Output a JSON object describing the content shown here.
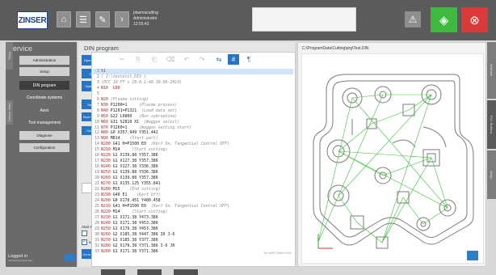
{
  "header": {
    "logo": "ZINSER",
    "user": {
      "line1": "plasmacutting",
      "line2": "Administrator",
      "line3": "12:55:43"
    },
    "icons": [
      "home-icon",
      "list-icon",
      "wrench-icon",
      "chevron-right-icon",
      "warning-icon",
      "start-icon",
      "stop-icon"
    ]
  },
  "left": {
    "title": "Service",
    "menu": [
      "Administration",
      "Setup",
      "DIN program",
      "Coordinate systems",
      "Axes",
      "Tool management",
      "Diagnose",
      "Configuration"
    ],
    "side_tabs": [
      "Setup",
      "Device State"
    ],
    "logged_in": "Logged in",
    "logged_user": "Administrator@domain"
  },
  "din": {
    "title": "DIN program",
    "buttons": [
      "Open current",
      "Open",
      "Open cycle",
      "Save as",
      "Save and load",
      "Close file",
      "Go to plan pos"
    ],
    "number_value": "0",
    "start_prog": "Start Prog:",
    "checkbox2": "5000"
  },
  "code_lines": [
    {
      "n": "1",
      "t": [
        [
          "kw",
          "%1"
        ]
      ]
    },
    {
      "n": "2",
      "t": [
        [
          "cm",
          "( J:\\testetit.DIV )"
        ]
      ]
    },
    {
      "n": "3",
      "t": [
        [
          "cm",
          "(PCC 10 FF v 10.0.1-40 10-06-2014)"
        ]
      ]
    },
    {
      "n": "4",
      "t": [
        [
          "kw",
          "N10"
        ],
        [
          "",
          "  "
        ],
        [
          "kw",
          "G90"
        ]
      ]
    },
    {
      "n": "5",
      "t": [
        [
          "",
          ""
        ]
      ]
    },
    {
      "n": "6",
      "t": [
        [
          "kw",
          "N20"
        ],
        [
          "",
          ""
        ],
        [
          "cm",
          " (Plasma cutting)"
        ]
      ]
    },
    {
      "n": "7",
      "t": [
        [
          "kw",
          "N30"
        ],
        [
          "",
          " P1200=1     "
        ],
        [
          "cm",
          "(Plasma process)"
        ]
      ]
    },
    {
      "n": "8",
      "t": [
        [
          "kw",
          "N40"
        ],
        [
          "",
          " P1201=P1321  "
        ],
        [
          "cm",
          "(Load data set)"
        ]
      ]
    },
    {
      "n": "9",
      "t": [
        [
          "kw",
          "N50"
        ],
        [
          "",
          " G22 L9800   "
        ],
        [
          "cm",
          "(Run subroutine)"
        ]
      ]
    },
    {
      "n": "10",
      "t": [
        [
          "kw",
          "N60"
        ],
        [
          "",
          " G31 S2810 X1  "
        ],
        [
          "cm",
          "(Waggon select)"
        ]
      ]
    },
    {
      "n": "11",
      "t": [
        [
          "kw",
          "N70"
        ],
        [
          "",
          " P1260=1     "
        ],
        [
          "cm",
          "(Waggon setting start)"
        ]
      ]
    },
    {
      "n": "12",
      "t": [
        [
          "kw",
          "N80"
        ],
        [
          "",
          " G0 X357.949 Y351.442"
        ]
      ]
    },
    {
      "n": "13",
      "t": [
        [
          "kw",
          "N90"
        ],
        [
          "",
          " M814    "
        ],
        [
          "cm",
          "(Start part)"
        ]
      ]
    },
    {
      "n": "14",
      "t": [
        [
          "kw",
          "N200"
        ],
        [
          "",
          " G41 H=P1500 E0  "
        ],
        [
          "cm",
          "(Kerf On, Tangential Control OFF)"
        ]
      ]
    },
    {
      "n": "15",
      "t": [
        [
          "kw",
          "N210"
        ],
        [
          "",
          " M14     "
        ],
        [
          "cm",
          "(Start cutting)"
        ]
      ]
    },
    {
      "n": "16",
      "t": [
        [
          "kw",
          "N220"
        ],
        [
          "",
          " G1 X139.88 Y357.386"
        ]
      ]
    },
    {
      "n": "17",
      "t": [
        [
          "kw",
          "N230"
        ],
        [
          "",
          " G1 X127.38 Y357.386"
        ]
      ]
    },
    {
      "n": "18",
      "t": [
        [
          "kw",
          "N240"
        ],
        [
          "",
          " G1 X127.38 Y336.386"
        ]
      ]
    },
    {
      "n": "19",
      "t": [
        [
          "kw",
          "N250"
        ],
        [
          "",
          " G1 X139.88 Y336.386"
        ]
      ]
    },
    {
      "n": "20",
      "t": [
        [
          "kw",
          "N260"
        ],
        [
          "",
          " G1 X139.88 Y357.386"
        ]
      ]
    },
    {
      "n": "21",
      "t": [
        [
          "kw",
          "N270"
        ],
        [
          "",
          " G1 X135.125 Y355.841"
        ]
      ]
    },
    {
      "n": "22",
      "t": [
        [
          "kw",
          "N280"
        ],
        [
          "",
          " M15    "
        ],
        [
          "cm",
          "(End cutting)"
        ]
      ]
    },
    {
      "n": "23",
      "t": [
        [
          "kw",
          "N290"
        ],
        [
          "",
          " G40 E1    "
        ],
        [
          "cm",
          "(Kerf Off)"
        ]
      ]
    },
    {
      "n": "24",
      "t": [
        [
          "kw",
          "N200"
        ],
        [
          "",
          " G0 X178.451 Y480.458"
        ]
      ]
    },
    {
      "n": "25",
      "t": [
        [
          "kw",
          "N210"
        ],
        [
          "",
          " G41 H=P1500 E0  "
        ],
        [
          "cm",
          "(Kerf On, Tangential Control OFF)"
        ]
      ]
    },
    {
      "n": "26",
      "t": [
        [
          "kw",
          "N220"
        ],
        [
          "",
          " M14     "
        ],
        [
          "cm",
          "(Start cutting)"
        ]
      ]
    },
    {
      "n": "27",
      "t": [
        [
          "kw",
          "N230"
        ],
        [
          "",
          " G1 X171.38 Y473.386"
        ]
      ]
    },
    {
      "n": "28",
      "t": [
        [
          "kw",
          "N240"
        ],
        [
          "",
          " G1 X171.38 Y453.386"
        ]
      ]
    },
    {
      "n": "29",
      "t": [
        [
          "kw",
          "N250"
        ],
        [
          "",
          " G1 X179.38 Y453.386"
        ]
      ]
    },
    {
      "n": "30",
      "t": [
        [
          "kw",
          "N260"
        ],
        [
          "",
          " G2 X185.38 Y447.386 I0 J-6"
        ]
      ]
    },
    {
      "n": "31",
      "t": [
        [
          "kw",
          "N270"
        ],
        [
          "",
          " G1 X185.38 Y377.386"
        ]
      ]
    },
    {
      "n": "32",
      "t": [
        [
          "kw",
          "N280"
        ],
        [
          "",
          " G2 X179.38 Y371.386 I-6 J0"
        ]
      ]
    },
    {
      "n": "33",
      "t": [
        [
          "kw",
          "N280"
        ],
        [
          "",
          " G1 X171.38 Y371.386"
        ]
      ]
    }
  ],
  "editor": {
    "status": "N1 NRR 20/80 1000"
  },
  "viewer": {
    "path": "C:\\ProgramData\\Cutting\\prg\\Test.DIN"
  },
  "right_tabs": [
    "Machine",
    "PLC Buttons",
    "Setup"
  ],
  "colors": {
    "accent": "#2574c8",
    "start": "#3ebb3e",
    "stop": "#d93a3a",
    "keyword": "#b42626",
    "contour": "#777777",
    "path": "#39c139"
  }
}
